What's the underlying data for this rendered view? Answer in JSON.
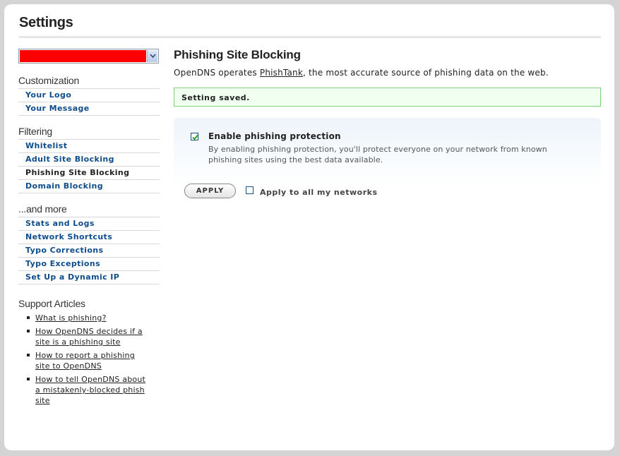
{
  "page": {
    "title": "Settings"
  },
  "network_select": {
    "selected_value": "",
    "selected_color": "#ff0000"
  },
  "sidebar": {
    "sections": [
      {
        "heading": "Customization",
        "items": [
          {
            "label": "Your Logo"
          },
          {
            "label": "Your Message"
          }
        ]
      },
      {
        "heading": "Filtering",
        "items": [
          {
            "label": "Whitelist"
          },
          {
            "label": "Adult Site Blocking"
          },
          {
            "label": "Phishing Site Blocking",
            "active": true
          },
          {
            "label": "Domain Blocking"
          }
        ]
      },
      {
        "heading": "...and more",
        "items": [
          {
            "label": "Stats and Logs"
          },
          {
            "label": "Network Shortcuts"
          },
          {
            "label": "Typo Corrections"
          },
          {
            "label": "Typo Exceptions"
          },
          {
            "label": "Set Up a Dynamic IP"
          }
        ]
      }
    ],
    "support": {
      "heading": "Support Articles",
      "articles": [
        "What is phishing?",
        "How OpenDNS decides if a site is a phishing site",
        "How to report a phishing site to OpenDNS",
        "How to tell OpenDNS about a mistakenly-blocked phish site"
      ]
    }
  },
  "main": {
    "title": "Phishing Site Blocking",
    "intro_prefix": "OpenDNS operates ",
    "intro_link": "PhishTank",
    "intro_suffix": ", the most accurate source of phishing data on the web.",
    "status_message": "Setting saved.",
    "option": {
      "label": "Enable phishing protection",
      "checked": true,
      "description": "By enabling phishing protection, you'll protect everyone on your network from known phishing sites using the best data available."
    },
    "apply_label": "APPLY",
    "apply_all_label": "Apply to all my networks",
    "apply_all_checked": false
  },
  "colors": {
    "link": "#0e4d8c",
    "success_border": "#7fd17f",
    "success_bg": "#f1fff1"
  }
}
